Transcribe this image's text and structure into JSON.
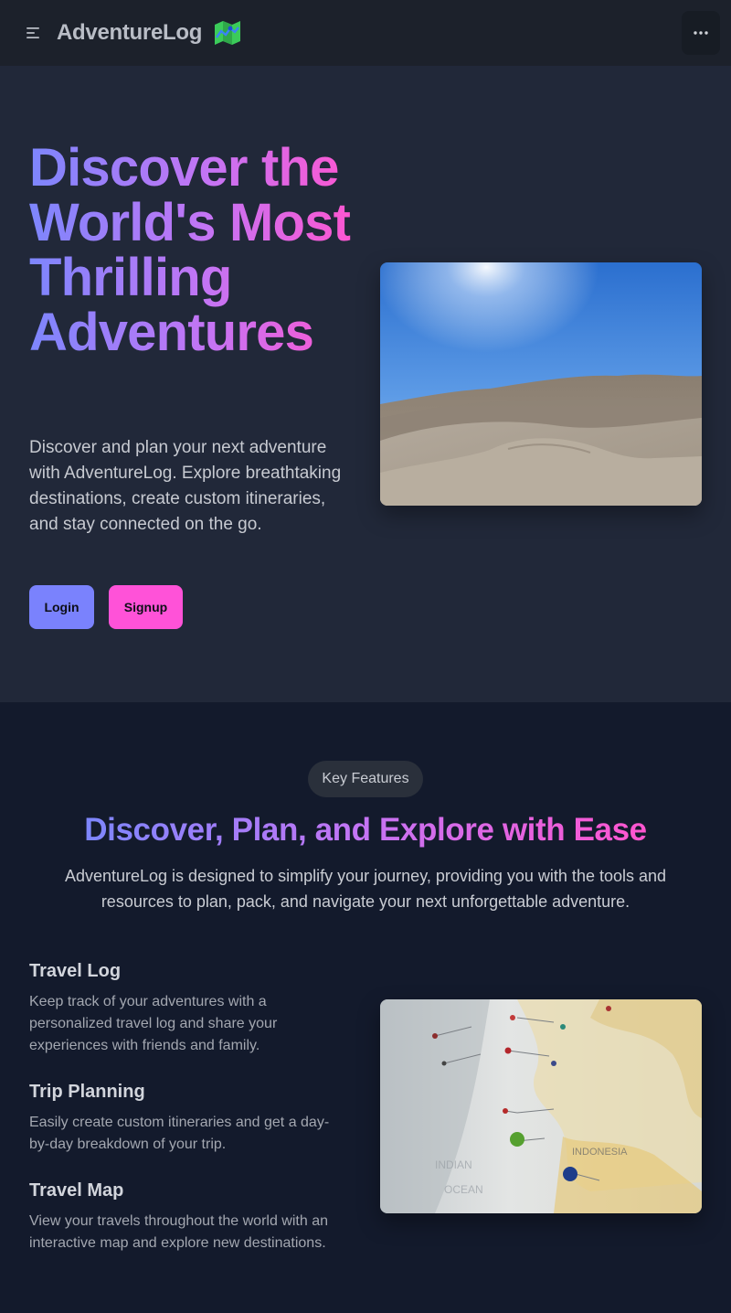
{
  "navbar": {
    "brand_title": "AdventureLog",
    "menu_icon": "menu-icon",
    "more_icon": "ellipsis-icon",
    "logo_icon": "map-icon"
  },
  "hero": {
    "title": "Discover the World's Most Thrilling Adventures",
    "description": "Discover and plan your next adventure with AdventureLog. Explore breathtaking destinations, create custom itineraries, and stay connected on the go.",
    "login_label": "Login",
    "signup_label": "Signup"
  },
  "features": {
    "badge": "Key Features",
    "heading": "Discover, Plan, and Explore with Ease",
    "description": "AdventureLog is designed to simplify your journey, providing you with the tools and resources to plan, pack, and navigate your next unforgettable adventure.",
    "items": [
      {
        "title": "Travel Log",
        "text": "Keep track of your adventures with a personalized travel log and share your experiences with friends and family."
      },
      {
        "title": "Trip Planning",
        "text": "Easily create custom itineraries and get a day-by-day breakdown of your trip."
      },
      {
        "title": "Travel Map",
        "text": "View your travels throughout the world with an interactive map and explore new destinations."
      }
    ]
  },
  "colors": {
    "primary": "#7a82fd",
    "secondary": "#ff52d8",
    "navbar_bg": "#1c212b",
    "hero_bg": "#212839",
    "features_bg": "#131a2c"
  }
}
